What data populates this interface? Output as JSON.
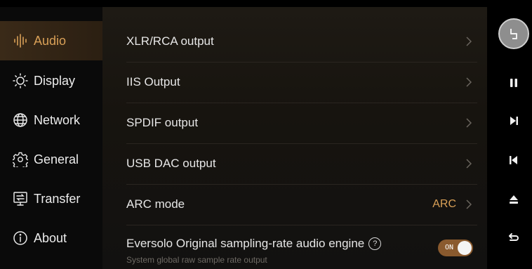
{
  "sidebar": {
    "items": [
      {
        "label": "Audio",
        "icon": "waveform-icon",
        "active": true
      },
      {
        "label": "Display",
        "icon": "sun-icon"
      },
      {
        "label": "Network",
        "icon": "globe-icon"
      },
      {
        "label": "General",
        "icon": "gear-icon"
      },
      {
        "label": "Transfer",
        "icon": "transfer-icon"
      },
      {
        "label": "About",
        "icon": "info-icon"
      }
    ]
  },
  "main": {
    "rows": [
      {
        "label": "XLR/RCA output"
      },
      {
        "label": "IIS Output"
      },
      {
        "label": "SPDIF output"
      },
      {
        "label": "USB DAC output"
      },
      {
        "label": "ARC mode",
        "value": "ARC"
      }
    ],
    "engine": {
      "label": "Eversolo Original sampling-rate audio engine",
      "help": "?",
      "subtitle": "System global raw sample rate output",
      "toggle_label": "ON"
    }
  },
  "controls": {
    "icons": [
      "avatar-icon",
      "pause-icon",
      "next-icon",
      "previous-icon",
      "eject-icon",
      "back-icon"
    ]
  },
  "colors": {
    "accent": "#d9a057",
    "toggle": "#8a5a2e",
    "background": "#17140f"
  }
}
